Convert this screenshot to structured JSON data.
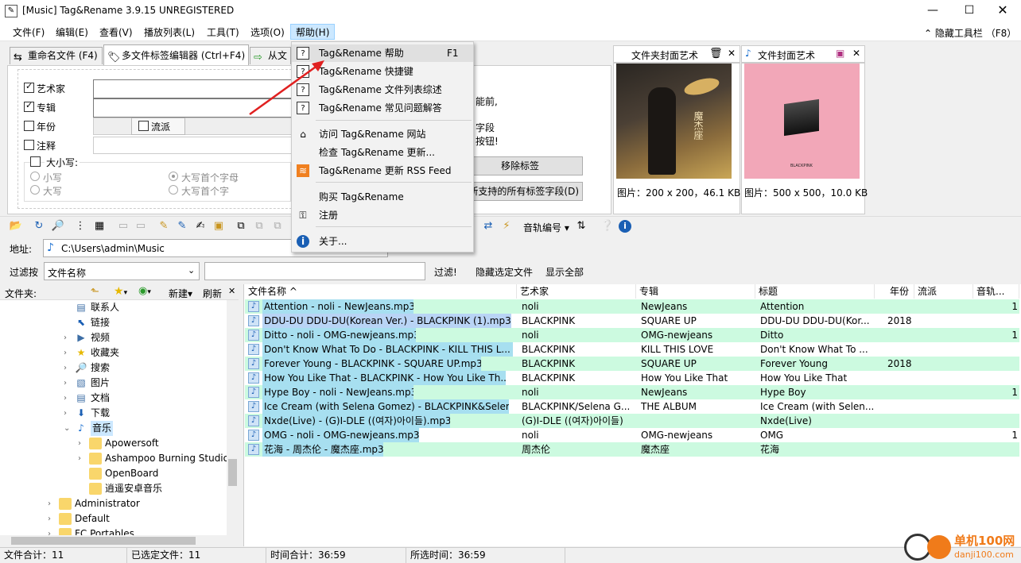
{
  "window": {
    "title": "[Music] Tag&Rename 3.9.15 UNREGISTERED"
  },
  "menu": {
    "items": [
      "文件(F)",
      "编辑(E)",
      "查看(V)",
      "播放列表(L)",
      "工具(T)",
      "选项(O)",
      "帮助(H)"
    ],
    "hide_toolbar": "隐藏工具栏 （F8）"
  },
  "tabs": [
    "重命名文件 (F4)",
    "多文件标签编辑器 (Ctrl+F4)",
    "从文"
  ],
  "editor": {
    "artist": "艺术家",
    "album": "专辑",
    "year": "年份",
    "comment": "注释",
    "genre": "流派",
    "case_label": "大小写:",
    "case_options": [
      "小写",
      "大写",
      "大写首个字母",
      "大写首个字"
    ],
    "info_lines": [
      "能前,",
      "字段",
      "按钮!"
    ],
    "remove_tags": "移除标签",
    "all_fields": "所支持的所有标签字段(D)"
  },
  "help_menu": {
    "items": [
      {
        "label": "Tag&Rename 帮助",
        "key": "F1",
        "icon": "?"
      },
      {
        "label": "Tag&Rename 快捷键",
        "key": "",
        "icon": "?"
      },
      {
        "label": "Tag&Rename 文件列表综述",
        "key": "",
        "icon": "?"
      },
      {
        "label": "Tag&Rename 常见问题解答",
        "key": "",
        "icon": "?"
      },
      {
        "label": "访问 Tag&Rename 网站",
        "key": "",
        "icon": "⌂"
      },
      {
        "label": "检查 Tag&Rename 更新...",
        "key": "",
        "icon": ""
      },
      {
        "label": "Tag&Rename 更新 RSS Feed",
        "key": "",
        "icon": "≋"
      },
      {
        "label": "购买 Tag&Rename",
        "key": "",
        "icon": ""
      },
      {
        "label": "注册",
        "key": "",
        "icon": "⚿"
      },
      {
        "label": "关于...",
        "key": "",
        "icon": "i"
      }
    ]
  },
  "cover": {
    "folder_cover_label": "文件夹封面艺术",
    "file_cover_label": "文件封面艺术",
    "folder_cover_info": "图片：200 x 200，46.1 KB",
    "file_cover_info": "图片：500 x 500，10.0 KB",
    "file_cover_text": "BLACKPINK",
    "folder_cover_text": "魔杰座"
  },
  "toolbar": {
    "track_number": "音轨编号"
  },
  "address": {
    "label": "地址:",
    "value": "C:\\Users\\admin\\Music"
  },
  "filter": {
    "label": "过滤按",
    "field": "文件名称",
    "filter_btn": "过滤!",
    "hide_selected": "隐藏选定文件",
    "show_all": "显示全部"
  },
  "folder_panel": {
    "label": "文件夹:",
    "new": "新建",
    "refresh": "刷新"
  },
  "tree": [
    {
      "label": "联系人",
      "indent": 1,
      "icon": "contacts"
    },
    {
      "label": "链接",
      "indent": 1,
      "icon": "link"
    },
    {
      "label": "视频",
      "indent": 1,
      "icon": "video",
      "expand": true
    },
    {
      "label": "收藏夹",
      "indent": 1,
      "icon": "star",
      "expand": true
    },
    {
      "label": "搜索",
      "indent": 1,
      "icon": "search",
      "expand": true
    },
    {
      "label": "图片",
      "indent": 1,
      "icon": "picture",
      "expand": true
    },
    {
      "label": "文档",
      "indent": 1,
      "icon": "document",
      "expand": true
    },
    {
      "label": "下载",
      "indent": 1,
      "icon": "download",
      "expand": true
    },
    {
      "label": "音乐",
      "indent": 1,
      "icon": "music",
      "expanded": true,
      "selected": true
    },
    {
      "label": "Apowersoft",
      "indent": 2,
      "icon": "folder",
      "expand": true
    },
    {
      "label": "Ashampoo Burning Studio",
      "indent": 2,
      "icon": "folder",
      "expand": true
    },
    {
      "label": "OpenBoard",
      "indent": 2,
      "icon": "folder"
    },
    {
      "label": "逍遥安卓音乐",
      "indent": 2,
      "icon": "folder"
    },
    {
      "label": "Administrator",
      "indent": 0,
      "icon": "folder",
      "expand": true
    },
    {
      "label": "Default",
      "indent": 0,
      "icon": "folder",
      "expand": true
    },
    {
      "label": "FC Portables",
      "indent": 0,
      "icon": "folder",
      "expand": true
    }
  ],
  "columns": [
    "文件名称",
    "艺术家",
    "专辑",
    "标题",
    "年份",
    "流派",
    "音轨..."
  ],
  "files": [
    {
      "name": "Attention - noli - NewJeans.mp3",
      "artist": "noli",
      "album": "NewJeans",
      "title": "Attention",
      "year": "",
      "track": "1",
      "style": "green"
    },
    {
      "name": "DDU-DU DDU-DU(Korean Ver.) - BLACKPINK (1).mp3",
      "artist": "BLACKPINK",
      "album": "SQUARE UP",
      "title": "DDU-DU DDU-DU(Kor...",
      "year": "2018",
      "track": "",
      "style": "white"
    },
    {
      "name": "Ditto - noli - OMG-newjeans.mp3",
      "artist": "noli",
      "album": "OMG-newjeans",
      "title": "Ditto",
      "year": "",
      "track": "1",
      "style": "green"
    },
    {
      "name": "Don't Know What To Do - BLACKPINK - KILL THIS L...",
      "artist": "BLACKPINK",
      "album": "KILL THIS LOVE",
      "title": "Don't Know What To ...",
      "year": "",
      "track": "",
      "style": "white"
    },
    {
      "name": "Forever Young - BLACKPINK - SQUARE UP.mp3",
      "artist": "BLACKPINK",
      "album": "SQUARE UP",
      "title": "Forever Young",
      "year": "2018",
      "track": "",
      "style": "green"
    },
    {
      "name": "How You Like That - BLACKPINK - How You Like Th...",
      "artist": "BLACKPINK",
      "album": "How You Like That",
      "title": "How You Like That",
      "year": "",
      "track": "",
      "style": "white"
    },
    {
      "name": "Hype Boy - noli - NewJeans.mp3",
      "artist": "noli",
      "album": "NewJeans",
      "title": "Hype Boy",
      "year": "",
      "track": "1",
      "style": "green"
    },
    {
      "name": "Ice Cream (with Selena Gomez) - BLACKPINK&Selen...",
      "artist": "BLACKPINK/Selena G...",
      "album": "THE ALBUM",
      "title": "Ice Cream (with Selen...",
      "year": "",
      "track": "",
      "style": "white"
    },
    {
      "name": "Nxde(Live) - (G)I-DLE ((여자)아이들).mp3",
      "artist": "(G)I-DLE ((여자)아이들)",
      "album": "",
      "title": "Nxde(Live)",
      "year": "",
      "track": "",
      "style": "green"
    },
    {
      "name": "OMG - noli - OMG-newjeans.mp3",
      "artist": "noli",
      "album": "OMG-newjeans",
      "title": "OMG",
      "year": "",
      "track": "1",
      "style": "white"
    },
    {
      "name": "花海 - 周杰伦 - 魔杰座.mp3",
      "artist": "周杰伦",
      "album": "魔杰座",
      "title": "花海",
      "year": "",
      "track": "",
      "style": "green"
    }
  ],
  "status": {
    "total": "文件合计：11",
    "selected": "已选定文件：11",
    "time_total": "时间合计：36:59",
    "selected_time": "所选时间：36:59"
  },
  "watermark": {
    "name": "单机100网",
    "url": "danji100.com"
  },
  "colors": {
    "row_green": "#ccfae0",
    "name_highlight": "#a7dff0",
    "selected_name": "#b9d4f5",
    "menu_active": "#cce8ff",
    "arrow_red": "#e02020"
  }
}
